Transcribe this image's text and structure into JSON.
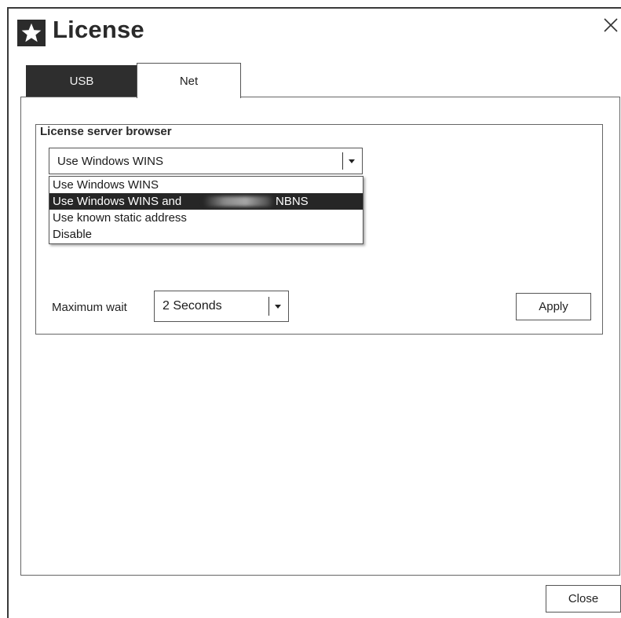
{
  "window": {
    "title": "License",
    "icon": "star-icon",
    "close_icon": "close-icon"
  },
  "tabs": [
    {
      "label": "USB",
      "active": false
    },
    {
      "label": "Net",
      "active": true
    }
  ],
  "group": {
    "title": "License server browser"
  },
  "browser_combo": {
    "value": "Use Windows  WINS",
    "options": [
      "Use Windows  WINS",
      "Use Windows  WINS and",
      "Use known static address",
      "Disable"
    ],
    "highlighted_option_suffix": "NBNS",
    "highlighted_index": 1
  },
  "max_wait": {
    "label": "Maximum wait",
    "value": "2 Seconds"
  },
  "buttons": {
    "apply": "Apply",
    "close": "Close"
  },
  "colors": {
    "dark": "#2e2e2e",
    "selection": "#262626",
    "border": "#555555"
  }
}
